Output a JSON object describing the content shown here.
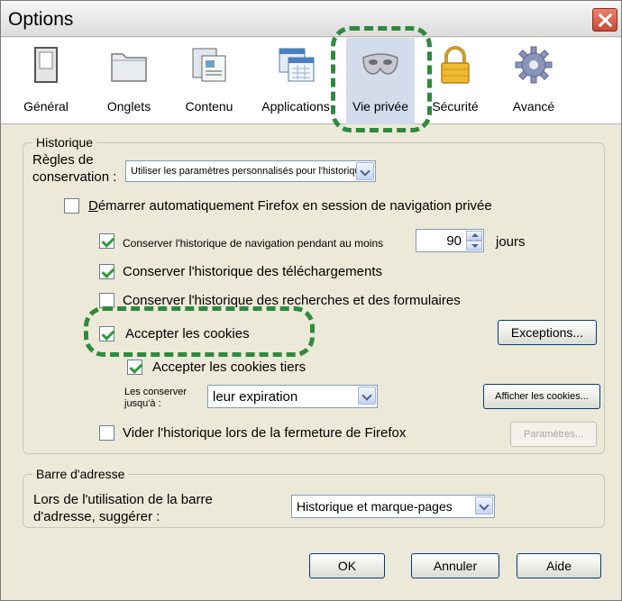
{
  "window": {
    "title": "Options"
  },
  "tabs": [
    {
      "label": "Général",
      "icon": "general-switch-icon"
    },
    {
      "label": "Onglets",
      "icon": "tabs-folder-icon"
    },
    {
      "label": "Contenu",
      "icon": "content-page-icon"
    },
    {
      "label": "Applications",
      "icon": "applications-window-icon"
    },
    {
      "label": "Vie privée",
      "icon": "privacy-mask-icon",
      "active": true
    },
    {
      "label": "Sécurité",
      "icon": "security-lock-icon"
    },
    {
      "label": "Avancé",
      "icon": "advanced-gear-icon"
    }
  ],
  "historique": {
    "legend": "Historique",
    "rules_label_line1": "Règles de",
    "rules_label_line2": "conservation :",
    "rules_value": "Utiliser les paramètres personnalisés pour l'historique",
    "auto_private": {
      "label": "Démarrer automatiquement Firefox en session de navigation privée",
      "checked": false
    },
    "keep_history": {
      "label": "Conserver l'historique de navigation pendant au moins",
      "checked": true,
      "days": "90",
      "unit": "jours"
    },
    "keep_downloads": {
      "label": "Conserver l'historique des téléchargements",
      "checked": true
    },
    "keep_search": {
      "label": "Conserver l'historique des recherches et des formulaires",
      "checked": false
    },
    "accept_cookies": {
      "label": "Accepter les cookies",
      "checked": true
    },
    "exceptions_button": "Exceptions...",
    "third_party": {
      "label": "Accepter les cookies tiers",
      "checked": true
    },
    "keep_until_line1": "Les conserver",
    "keep_until_line2": "jusqu'à :",
    "keep_until_value": "leur expiration",
    "show_cookies_button": "Afficher les cookies...",
    "clear_on_close": {
      "label": "Vider l'historique lors de la fermeture de Firefox",
      "checked": false
    },
    "settings_button": "Paramètres..."
  },
  "address_bar": {
    "legend": "Barre d'adresse",
    "suggest_line1": "Lors de l'utilisation de la barre",
    "suggest_line2": "d'adresse, suggérer :",
    "suggest_value": "Historique et marque-pages"
  },
  "buttons": {
    "ok": "OK",
    "cancel": "Annuler",
    "help": "Aide"
  },
  "colors": {
    "highlight": "#2e8a3d",
    "check": "#2d9b3a",
    "dialog_bg": "#ece9d8"
  }
}
